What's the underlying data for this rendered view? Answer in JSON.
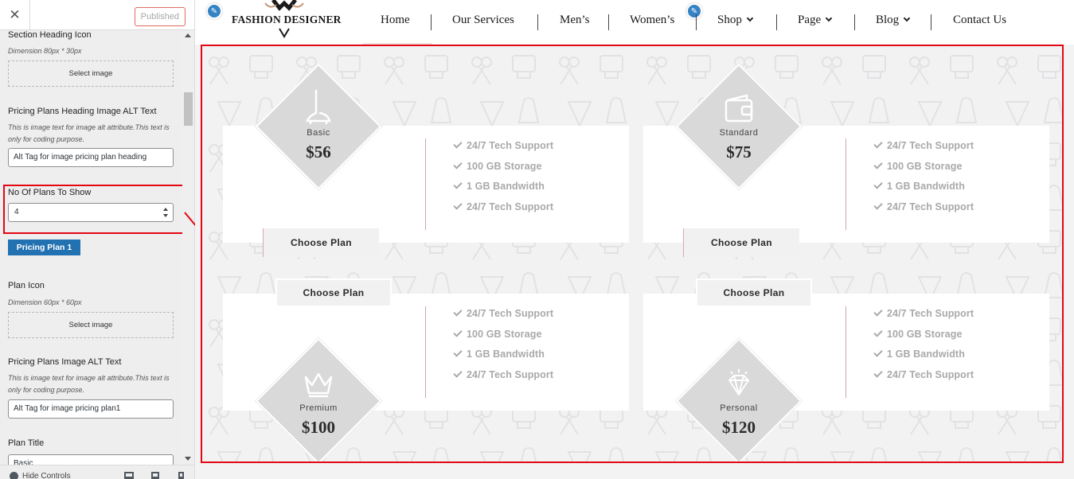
{
  "sidebar": {
    "close_glyph": "✕",
    "publish_label": "Published",
    "controls": {
      "heading_icon": {
        "title": "Section Heading Icon",
        "desc": "Dimension 80px * 30px",
        "button": "Select image"
      },
      "heading_alt": {
        "title": "Pricing Plans Heading Image ALT Text",
        "desc": "This is image text for image alt attribute.This text is only for coding purpose.",
        "value": "Alt Tag for image pricing plan heading"
      },
      "plans_count": {
        "title": "No Of Plans To Show",
        "value": "4"
      },
      "plan_tab": "Pricing Plan 1",
      "plan_icon": {
        "title": "Plan Icon",
        "desc": "Dimension 60px * 60px",
        "button": "Select image"
      },
      "plan_alt": {
        "title": "Pricing Plans Image ALT Text",
        "desc": "This is image text for image alt attribute.This text is only for coding purpose.",
        "value": "Alt Tag for image pricing plan1"
      },
      "plan_title": {
        "title": "Plan Title",
        "value": "Basic"
      }
    },
    "footer": {
      "hide_controls": "Hide Controls"
    }
  },
  "site": {
    "logo_text": "FASHION DESIGNER",
    "nav": [
      {
        "label": "Home"
      },
      {
        "label": "Our Services"
      },
      {
        "label": "Men’s"
      },
      {
        "label": "Women’s"
      },
      {
        "label": "Shop"
      },
      {
        "label": "Page"
      },
      {
        "label": "Blog"
      },
      {
        "label": "Contact Us"
      }
    ]
  },
  "pricing": {
    "plans": [
      {
        "name": "Basic",
        "price": "$56",
        "icon": "iron-icon",
        "button": "Choose Plan",
        "features": [
          "24/7 Tech Support",
          "100 GB Storage",
          "1 GB Bandwidth",
          "24/7 Tech Support"
        ]
      },
      {
        "name": "Standard",
        "price": "$75",
        "icon": "wallet-icon",
        "button": "Choose Plan",
        "features": [
          "24/7 Tech Support",
          "100 GB Storage",
          "1 GB Bandwidth",
          "24/7 Tech Support"
        ]
      },
      {
        "name": "Premium",
        "price": "$100",
        "icon": "crown-icon",
        "button": "Choose Plan",
        "features": [
          "24/7 Tech Support",
          "100 GB Storage",
          "1 GB Bandwidth",
          "24/7 Tech Support"
        ]
      },
      {
        "name": "Personal",
        "price": "$120",
        "icon": "diamond-gem-icon",
        "button": "Choose Plan",
        "features": [
          "24/7 Tech Support",
          "100 GB Storage",
          "1 GB Bandwidth",
          "24/7 Tech Support"
        ]
      }
    ]
  },
  "colors": {
    "highlight": "#e30613",
    "wp_blue": "#2271b1",
    "diamond_grey": "#d9d9d9",
    "feature_grey": "#a9a9a9"
  }
}
